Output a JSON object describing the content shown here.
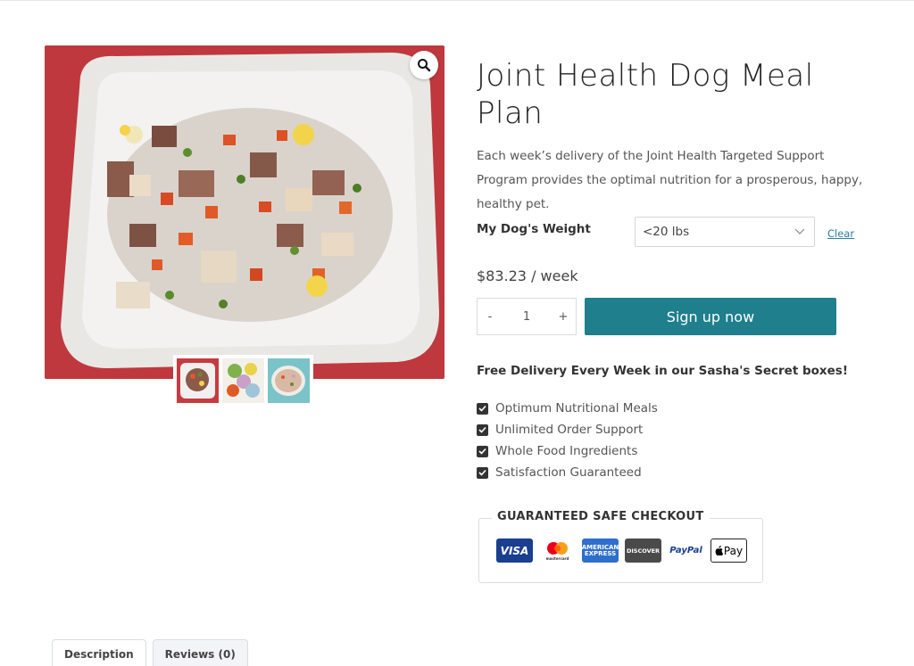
{
  "product": {
    "title": "Joint Health Dog Meal Plan",
    "description": "Each week’s delivery of the Joint Health Targeted Support Program provides the optimal nutrition for a prosperous, happy, healthy pet.",
    "price": "$83.23 / week"
  },
  "gallery": {
    "zoom_icon": "search-icon",
    "thumbnail_count": 3
  },
  "variation": {
    "label": "My Dog's Weight",
    "selected": "<20 lbs",
    "clear_label": "Clear"
  },
  "cart": {
    "quantity": "1",
    "minus_label": "-",
    "plus_label": "+",
    "button_label": "Sign up now"
  },
  "features": {
    "heading": "Free Delivery Every Week in our Sasha's Secret boxes!",
    "items": [
      "Optimum Nutritional Meals",
      "Unlimited Order Support",
      "Whole Food Ingredients",
      "Satisfaction Guaranteed"
    ]
  },
  "checkout": {
    "title": "GUARANTEED SAFE CHECKOUT",
    "cards": {
      "visa": "VISA",
      "mastercard_text": "mastercard",
      "amex_line1": "AMERICAN",
      "amex_line2": "EXPRESS",
      "discover": "DISCOVER",
      "paypal": "PayPal",
      "applepay": "Pay"
    }
  },
  "tabs": [
    "Description",
    "Reviews (0)"
  ],
  "colors": {
    "accent": "#1f7f8c",
    "link": "#2a7d98",
    "checkbox": "#333333"
  }
}
